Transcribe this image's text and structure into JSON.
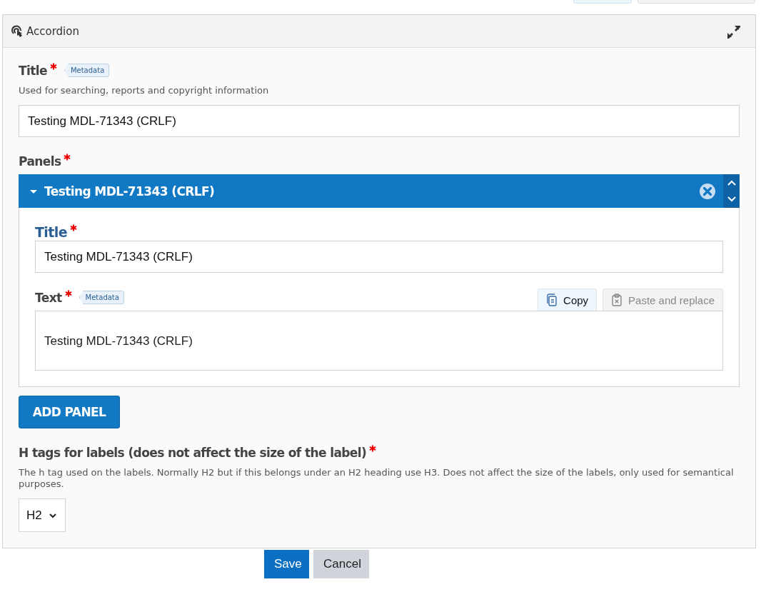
{
  "top_buttons": [
    {
      "kind": "light"
    },
    {
      "kind": "grey"
    }
  ],
  "widget": {
    "title": "Accordion"
  },
  "title_field": {
    "label": "Title",
    "required": true,
    "badge": "Metadata",
    "help": "Used for searching, reports and copyright information",
    "value": "Testing MDL-71343 (CRLF)"
  },
  "panels": {
    "label": "Panels",
    "required": true,
    "items": [
      {
        "title": "Testing MDL-71343 (CRLF)",
        "expanded": true,
        "title_field": {
          "label": "Title",
          "required": true,
          "value": "Testing MDL-71343 (CRLF)"
        },
        "text_field": {
          "label": "Text",
          "required": true,
          "badge": "Metadata",
          "copy": "Copy",
          "paste": "Paste and replace",
          "value": "Testing MDL-71343 (CRLF)"
        }
      }
    ],
    "add_button": "ADD PANEL"
  },
  "htag_field": {
    "label": "H tags for labels (does not affect the size of the label)",
    "required": true,
    "help": "The h tag used on the labels. Normally H2 but if this belongs under an H2 heading use H3. Does not affect the size of the labels, only used for semantical purposes.",
    "value": "H2"
  },
  "buttons": {
    "save": "Save",
    "cancel": "Cancel"
  }
}
